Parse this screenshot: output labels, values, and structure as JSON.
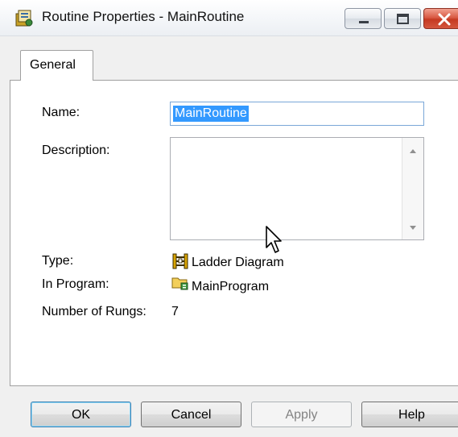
{
  "window": {
    "title": "Routine Properties - MainRoutine",
    "icon": "properties-icon"
  },
  "tabs": [
    {
      "label": "General",
      "active": true
    }
  ],
  "form": {
    "name_label": "Name:",
    "name_value": "MainRoutine",
    "description_label": "Description:",
    "description_value": "",
    "type_label": "Type:",
    "type_value": "Ladder Diagram",
    "type_icon": "ladder-diagram-icon",
    "program_label": "In Program:",
    "program_value": "MainProgram",
    "program_icon": "program-folder-icon",
    "rungs_label": "Number of Rungs:",
    "rungs_value": "7"
  },
  "buttons": {
    "ok": "OK",
    "cancel": "Cancel",
    "apply": "Apply",
    "help": "Help"
  },
  "colors": {
    "selection": "#3399ff",
    "close_button": "#c53a22",
    "focus_border": "#7aa7d8"
  }
}
